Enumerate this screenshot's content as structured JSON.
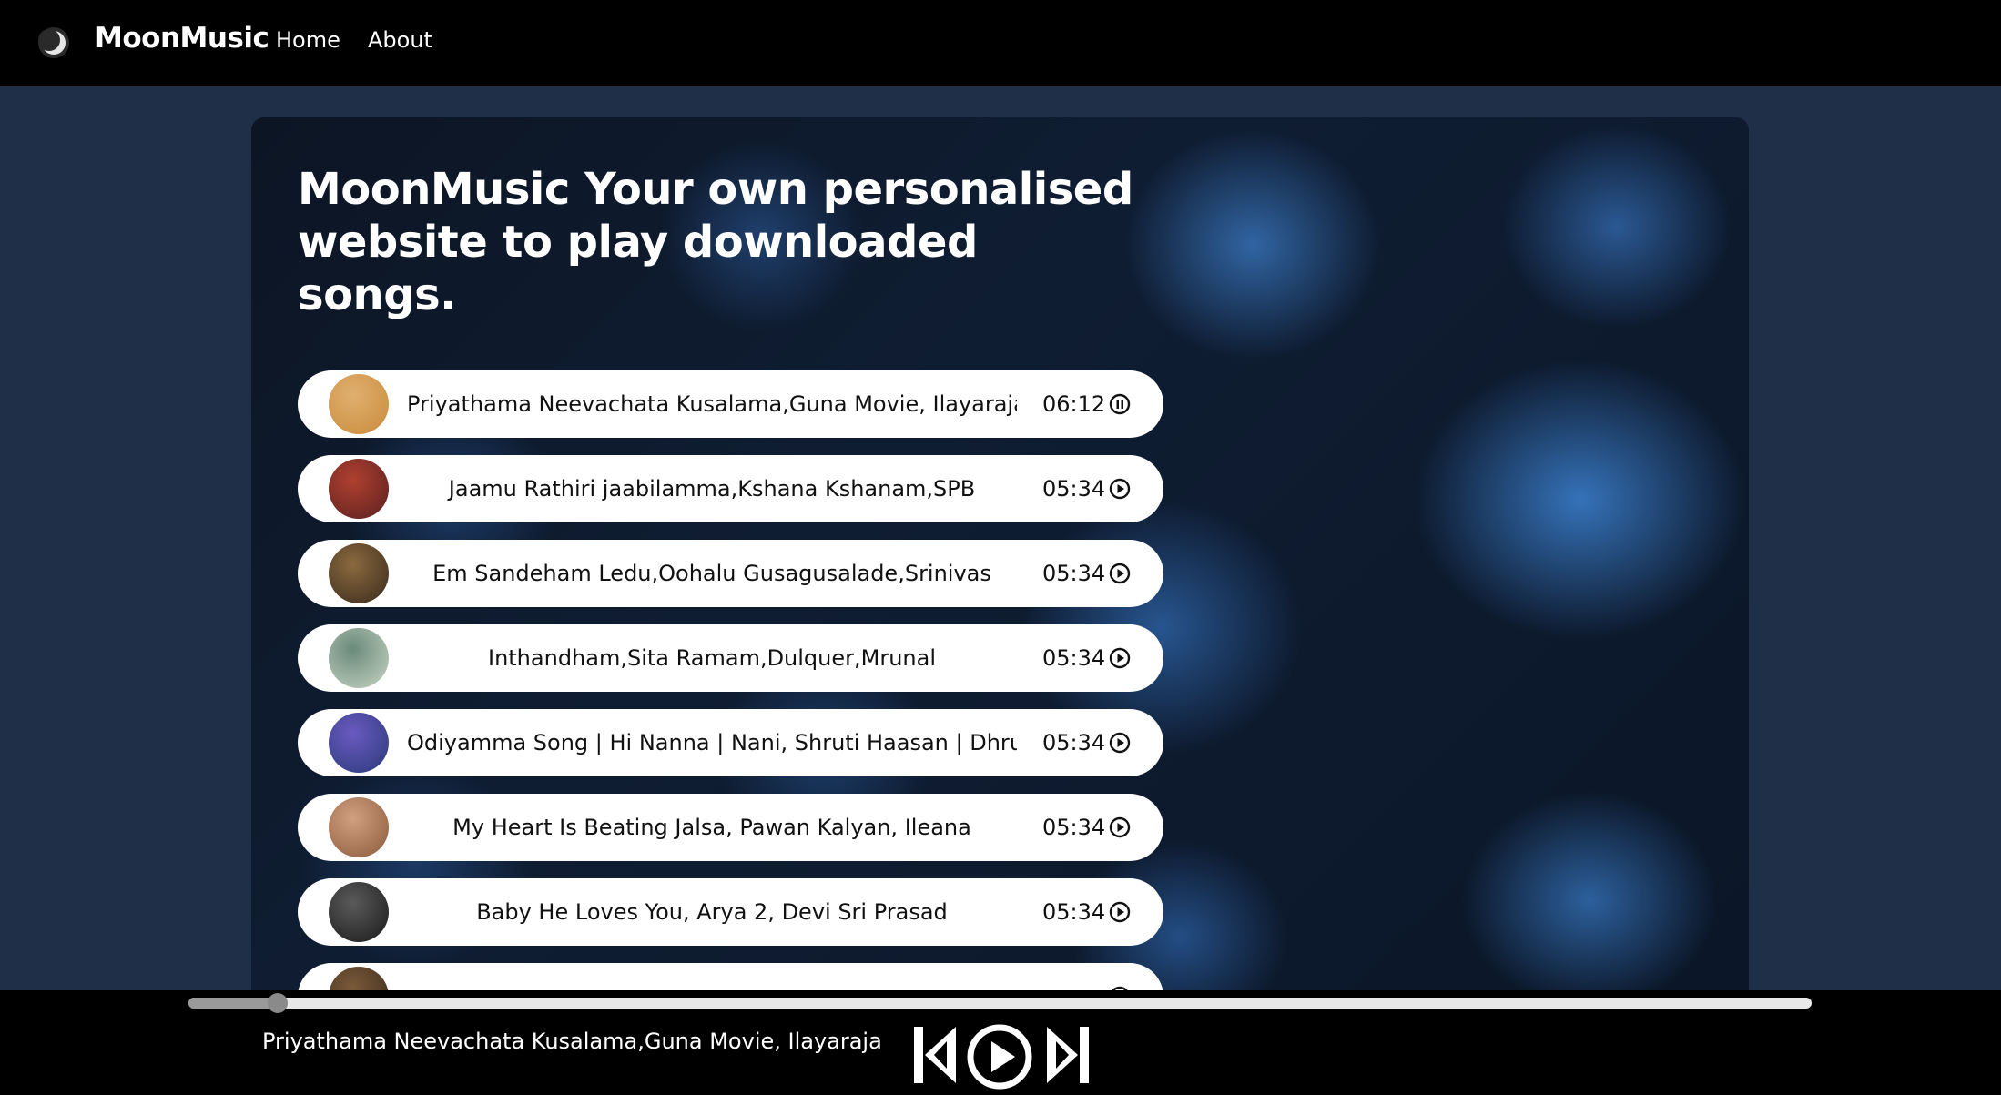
{
  "nav": {
    "brand": "MoonMusic",
    "links": [
      "Home",
      "About"
    ]
  },
  "hero": {
    "title": "MoonMusic Your own personalised website to play downloaded songs."
  },
  "songs": [
    {
      "title": "Priyathama Neevachata Kusalama,Guna Movie, Ilayaraja",
      "duration": "06:12",
      "state": "pause-icon",
      "thumb_colors": [
        "#c98a3a",
        "#e0b070"
      ]
    },
    {
      "title": "Jaamu Rathiri jaabilamma,Kshana Kshanam,SPB",
      "duration": "05:34",
      "state": "play-icon",
      "thumb_colors": [
        "#5a2020",
        "#b04030"
      ]
    },
    {
      "title": "Em Sandeham Ledu,Oohalu Gusagusalade,Srinivas",
      "duration": "05:34",
      "state": "play-icon",
      "thumb_colors": [
        "#3a2a1a",
        "#8a6a40"
      ]
    },
    {
      "title": "Inthandham,Sita Ramam,Dulquer,Mrunal",
      "duration": "05:34",
      "state": "play-icon",
      "thumb_colors": [
        "#c8d4c4",
        "#6a8a7a"
      ]
    },
    {
      "title": "Odiyamma Song | Hi Nanna | Nani, Shruti Haasan | Dhruv",
      "duration": "05:34",
      "state": "play-icon",
      "thumb_colors": [
        "#2a3a7a",
        "#6a5ac0"
      ]
    },
    {
      "title": "My Heart Is Beating Jalsa, Pawan Kalyan, Ileana",
      "duration": "05:34",
      "state": "play-icon",
      "thumb_colors": [
        "#8a5a3a",
        "#d0a080"
      ]
    },
    {
      "title": "Baby He Loves You, Arya 2, Devi Sri Prasad",
      "duration": "05:34",
      "state": "play-icon",
      "thumb_colors": [
        "#1a1a1a",
        "#5a5a5a"
      ]
    },
    {
      "title": "",
      "duration": "",
      "state": "play-icon",
      "thumb_colors": [
        "#3a2a1a",
        "#7a5a3a"
      ]
    }
  ],
  "player": {
    "now_playing": "Priyathama Neevachata Kusalama,Guna Movie, Ilayaraja",
    "progress_fraction": 0.055
  },
  "colors": {
    "page_bg": "#1f2f47",
    "bar_bg": "#000000",
    "row_bg": "#ffffff"
  }
}
